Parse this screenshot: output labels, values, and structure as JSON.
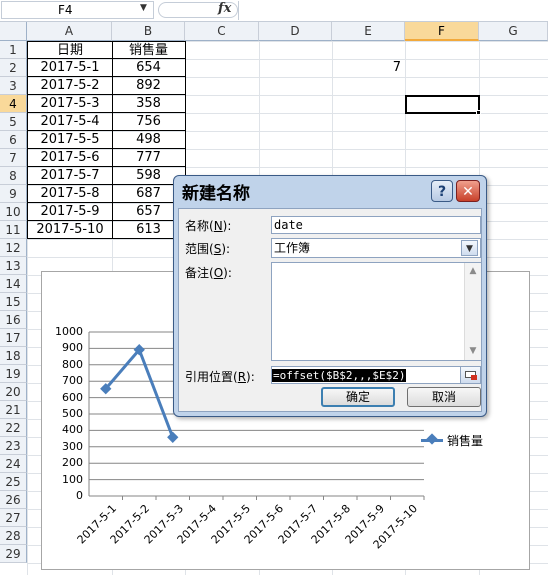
{
  "formula_bar": {
    "name_box": "F4",
    "name_box_arrow": "▼",
    "fx_icon": "fx",
    "formula": ""
  },
  "columns": [
    "A",
    "B",
    "C",
    "D",
    "E",
    "F",
    "G"
  ],
  "selected_column": "F",
  "rows": [
    "1",
    "2",
    "3",
    "4",
    "5",
    "6",
    "7",
    "8",
    "9",
    "10",
    "11",
    "12",
    "13",
    "14",
    "15",
    "16",
    "17",
    "18",
    "19",
    "20",
    "21",
    "22",
    "23",
    "24",
    "25",
    "26",
    "27",
    "28",
    "29"
  ],
  "selected_row": "4",
  "table": {
    "headers": [
      "日期",
      "销售量"
    ],
    "rows": [
      [
        "2017-5-1",
        "654"
      ],
      [
        "2017-5-2",
        "892"
      ],
      [
        "2017-5-3",
        "358"
      ],
      [
        "2017-5-4",
        "756"
      ],
      [
        "2017-5-5",
        "498"
      ],
      [
        "2017-5-6",
        "777"
      ],
      [
        "2017-5-7",
        "598"
      ],
      [
        "2017-5-8",
        "687"
      ],
      [
        "2017-5-9",
        "657"
      ],
      [
        "2017-5-10",
        "613"
      ]
    ]
  },
  "cell_e2": "7",
  "chart_data": {
    "type": "line",
    "categories": [
      "2017-5-1",
      "2017-5-2",
      "2017-5-3",
      "2017-5-4",
      "2017-5-5",
      "2017-5-6",
      "2017-5-7",
      "2017-5-8",
      "2017-5-9",
      "2017-5-10"
    ],
    "series": [
      {
        "name": "销售量",
        "values": [
          654,
          892,
          358,
          null,
          null,
          null,
          null,
          null,
          null,
          null
        ]
      }
    ],
    "ylim": [
      0,
      1000
    ],
    "yticks": [
      "1000",
      "900",
      "800",
      "700",
      "600",
      "500",
      "400",
      "300",
      "200",
      "100",
      "0"
    ],
    "legend": "right",
    "grid": true,
    "color": "#4a7ebb"
  },
  "dialog": {
    "title": "新建名称",
    "help_icon": "?",
    "close_icon": "✕",
    "name_label": "名称(",
    "name_key": "N",
    "name_label_end": "):",
    "name_value": "date",
    "scope_label": "范围(",
    "scope_key": "S",
    "scope_label_end": "):",
    "scope_value": "工作簿",
    "scope_arrow": "▼",
    "comment_label": "备注(",
    "comment_key": "O",
    "comment_label_end": "):",
    "comment_value": "",
    "scroll_up": "▲",
    "scroll_down": "▼",
    "ref_label": "引用位置(",
    "ref_key": "R",
    "ref_label_end": "):",
    "ref_value": "=offset($B$2,,,$E$2)",
    "ok": "确定",
    "cancel": "取消"
  }
}
